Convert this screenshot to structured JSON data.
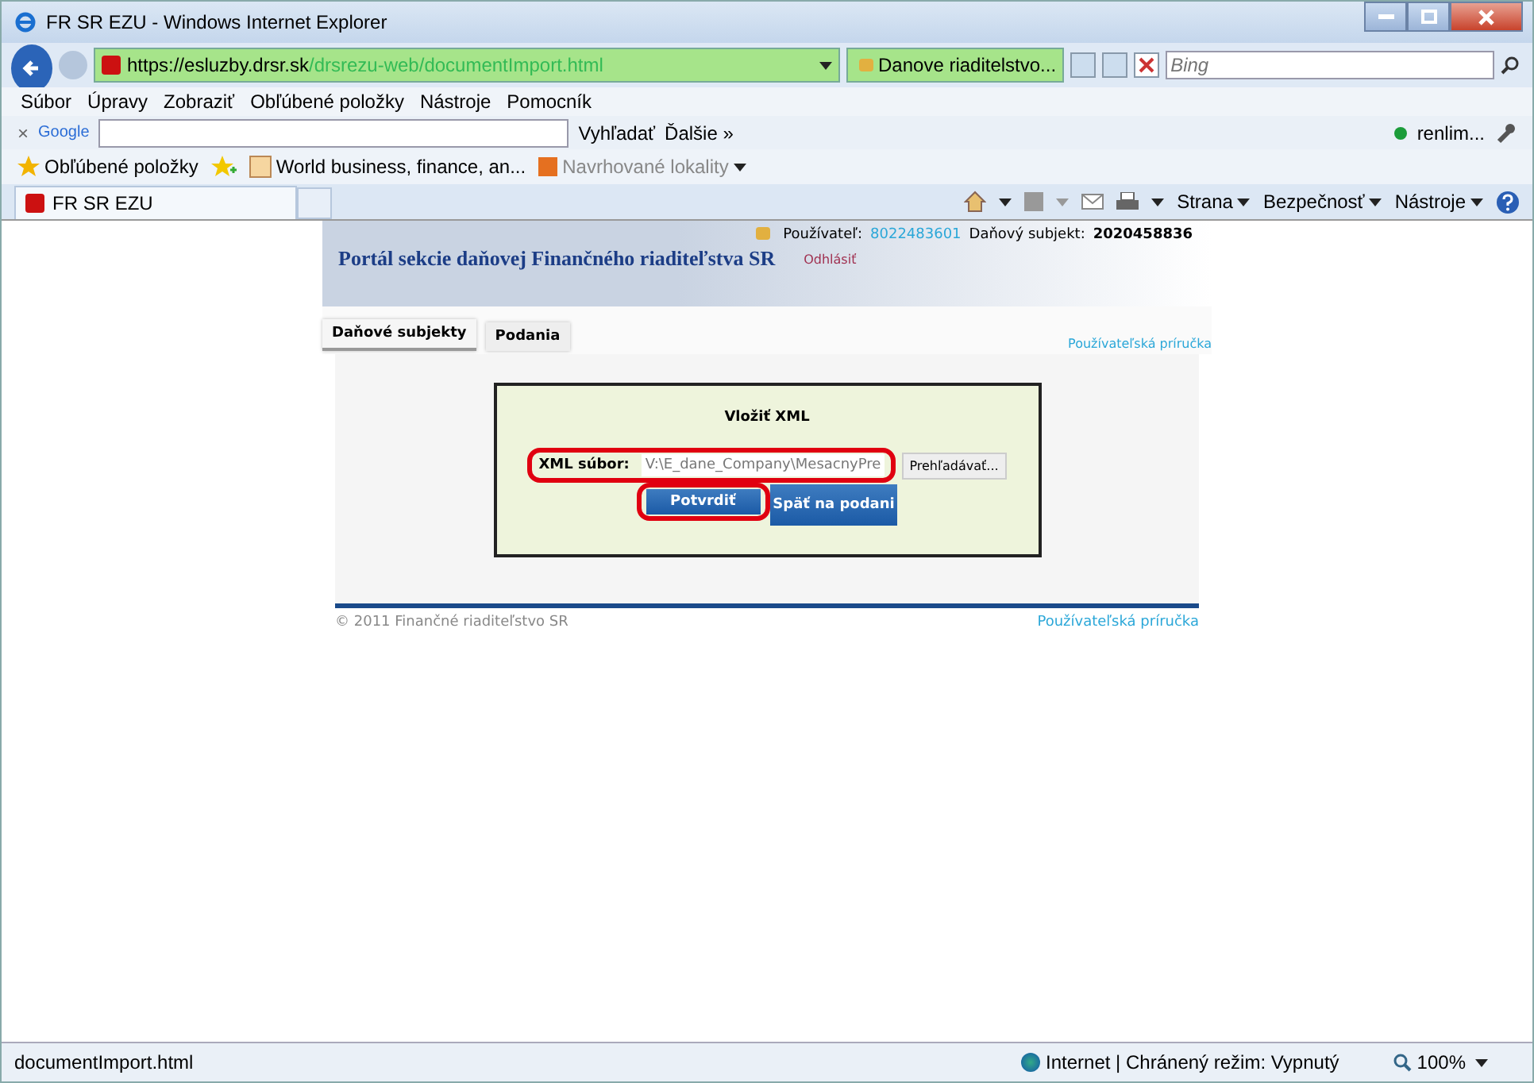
{
  "window": {
    "title": "FR SR EZU - Windows Internet Explorer"
  },
  "address_bar": {
    "url_host": "https://esluzby.drsr.sk",
    "url_path": "/drsrezu-web/documentImport.html",
    "site_identity": "Danove riaditelstvo...",
    "search_placeholder": "Bing"
  },
  "menu": [
    "Súbor",
    "Úpravy",
    "Zobraziť",
    "Obľúbené položky",
    "Nástroje",
    "Pomocník"
  ],
  "google_toolbar": {
    "close": "×",
    "logo": "Google",
    "search_button": "Vyhľadať",
    "more": "Ďalšie »",
    "account": "renlim..."
  },
  "favorites_bar": {
    "label": "Obľúbené položky",
    "items": [
      "World business, finance, an...",
      "Navrhované lokality"
    ]
  },
  "tab": {
    "title": "FR SR EZU"
  },
  "command_bar": [
    "Strana",
    "Bezpečnosť",
    "Nástroje"
  ],
  "page": {
    "header": {
      "user_label": "Používateľ:",
      "user_id": "8022483601",
      "subject_label": "Daňový subjekt:",
      "subject_id": "2020458836",
      "portal_title": "Portál sekcie daňovej Finančného riaditeľstva SR",
      "logout": "Odhlásiť"
    },
    "nav_tabs": [
      {
        "label": "Daňové subjekty",
        "selected": true
      },
      {
        "label": "Podania",
        "selected": false
      }
    ],
    "help_link": "Používateľská príručka",
    "dialog": {
      "title": "Vložiť XML",
      "field_label": "XML súbor:",
      "field_value": "V:\\E_dane_Company\\MesacnyPre",
      "browse": "Prehľadávať...",
      "confirm": "Potvrdiť",
      "back": "Späť na podani"
    },
    "footer": {
      "copyright": "© 2011 Finančné riaditeľstvo SR",
      "help_link": "Používateľská príručka"
    }
  },
  "status_bar": {
    "url": "documentImport.html",
    "zone": "Internet | Chránený režim: Vypnutý",
    "zoom": "100%"
  }
}
